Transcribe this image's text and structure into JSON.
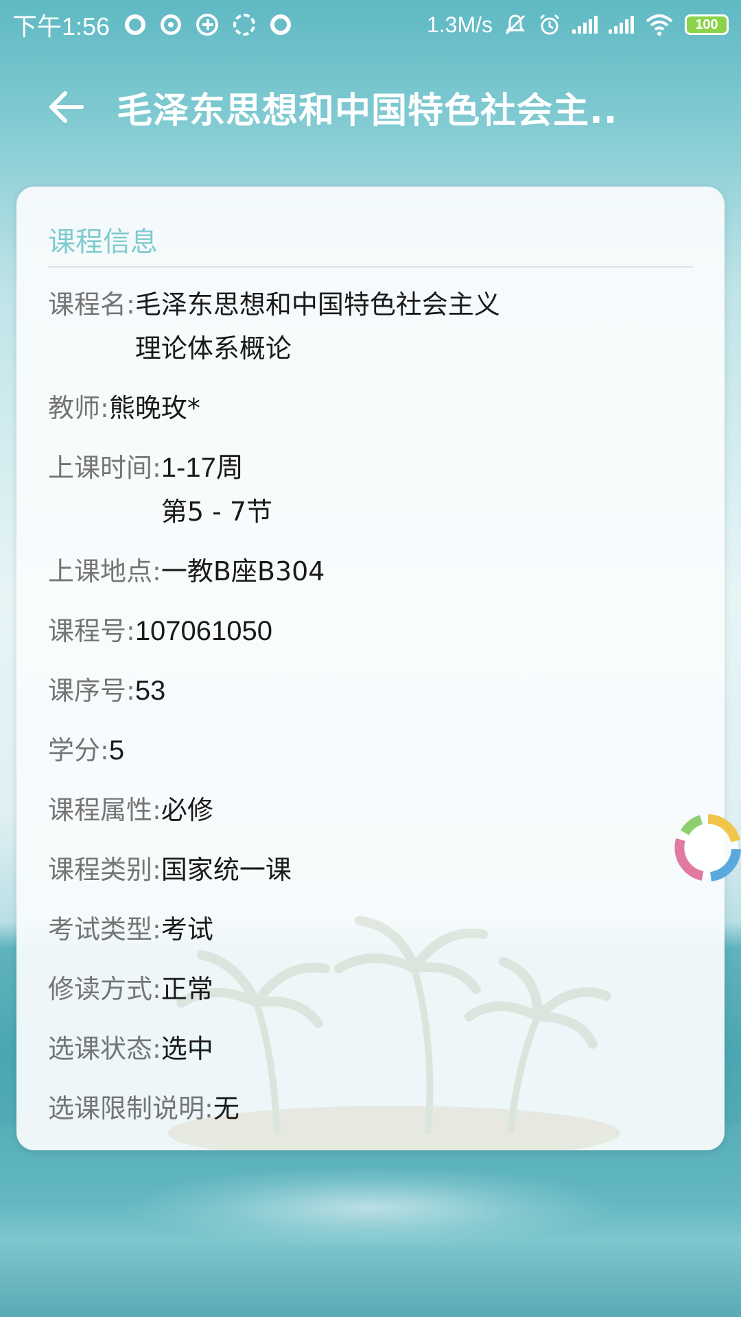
{
  "status_bar": {
    "time": "下午1:56",
    "network_speed": "1.3M/s",
    "battery": "100",
    "icons": [
      "notification-ring-icon",
      "chat-bubble-icon",
      "plus-circle-icon",
      "loading-ring-icon",
      "notification-ring-icon",
      "mute-icon",
      "alarm-icon",
      "signal-icon",
      "signal-icon",
      "wifi-icon",
      "battery-icon"
    ]
  },
  "header": {
    "back_icon": "arrow-left-icon",
    "title": "毛泽东思想和中国特色社会主.."
  },
  "card": {
    "section_title": "课程信息",
    "rows": [
      {
        "label": "课程名:",
        "lines": [
          "毛泽东思想和中国特色社会主义",
          "理论体系概论"
        ]
      },
      {
        "label": "教师:",
        "lines": [
          "熊晚玫*"
        ]
      },
      {
        "label": "上课时间:",
        "lines": [
          "1-17周",
          "第5 - 7节"
        ]
      },
      {
        "label": "上课地点:",
        "lines": [
          "一教B座B304"
        ]
      },
      {
        "label": "课程号:",
        "lines": [
          "107061050"
        ]
      },
      {
        "label": "课序号:",
        "lines": [
          "53"
        ]
      },
      {
        "label": "学分:",
        "lines": [
          "5"
        ]
      },
      {
        "label": "课程属性:",
        "lines": [
          "必修"
        ]
      },
      {
        "label": "课程类别:",
        "lines": [
          "国家统一课"
        ]
      },
      {
        "label": "考试类型:",
        "lines": [
          "考试"
        ]
      },
      {
        "label": "修读方式:",
        "lines": [
          "正常"
        ]
      },
      {
        "label": "选课状态:",
        "lines": [
          "选中"
        ]
      },
      {
        "label": "选课限制说明:",
        "lines": [
          "无"
        ]
      }
    ]
  },
  "colors": {
    "section_title": "#7fcbcf",
    "label": "#757575",
    "value": "#1a1a1a",
    "header_text": "#ffffff"
  }
}
